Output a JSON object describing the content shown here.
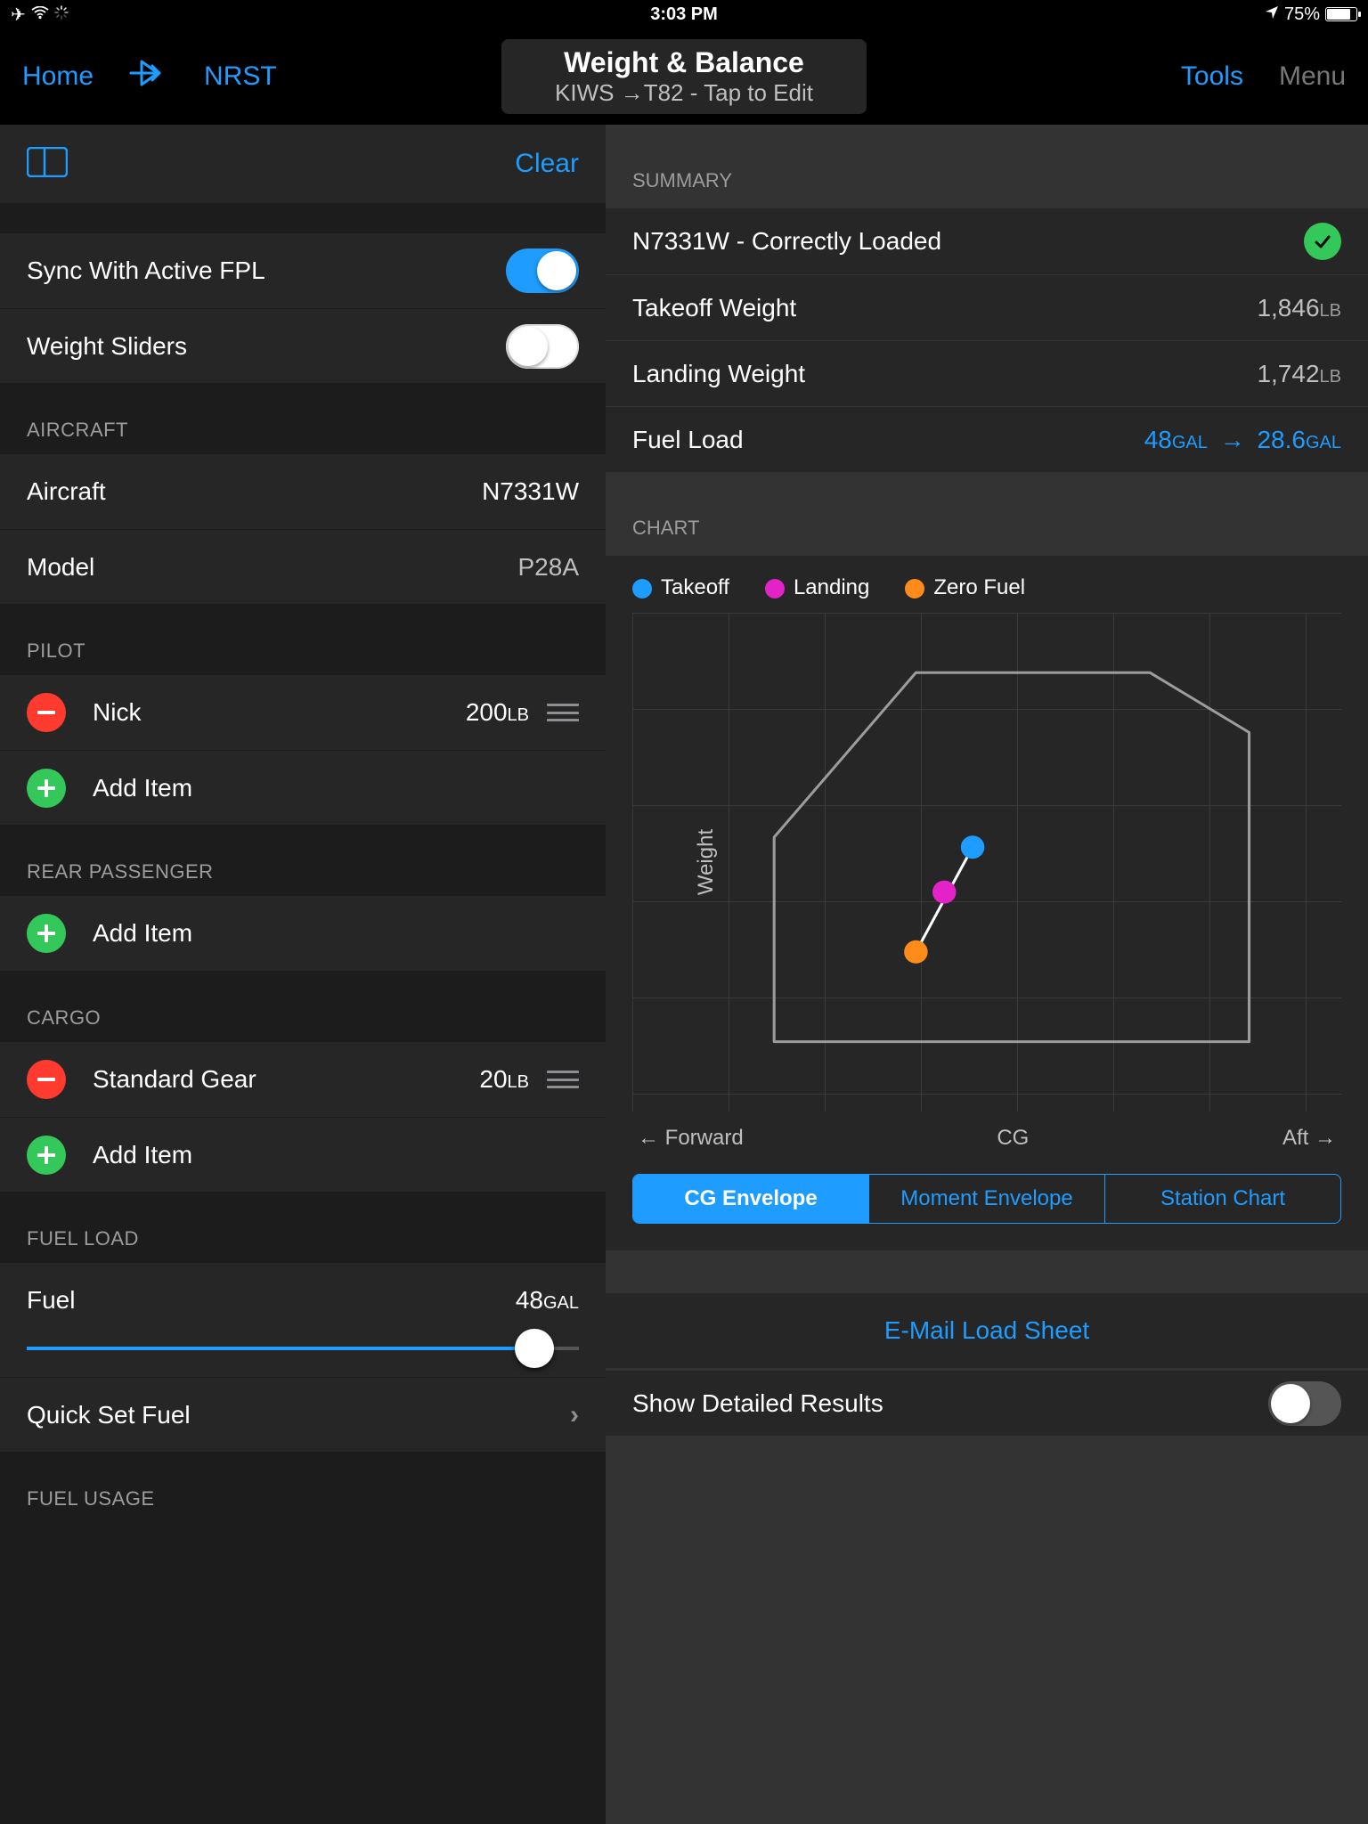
{
  "status": {
    "time": "3:03 PM",
    "battery": "75%"
  },
  "nav": {
    "home": "Home",
    "nrst": "NRST",
    "title": "Weight & Balance",
    "subtitle": "KIWS →T82 - Tap to Edit",
    "tools": "Tools",
    "menu": "Menu"
  },
  "left": {
    "clear": "Clear",
    "sync": "Sync With Active FPL",
    "sliders": "Weight Sliders",
    "aircraft_hdr": "AIRCRAFT",
    "aircraft_lbl": "Aircraft",
    "aircraft_val": "N7331W",
    "model_lbl": "Model",
    "model_val": "P28A",
    "pilot_hdr": "PILOT",
    "pilot_name": "Nick",
    "pilot_wt": "200",
    "lb": "LB",
    "add_item": "Add Item",
    "rear_hdr": "REAR PASSENGER",
    "cargo_hdr": "CARGO",
    "gear_lbl": "Standard Gear",
    "gear_wt": "20",
    "fuel_hdr": "FUEL LOAD",
    "fuel_lbl": "Fuel",
    "fuel_val": "48",
    "gal": "GAL",
    "fuel_pct": 92,
    "quickset": "Quick Set Fuel",
    "usage_hdr": "FUEL USAGE"
  },
  "right": {
    "summary_hdr": "SUMMARY",
    "status_line": "N7331W - Correctly Loaded",
    "tow_lbl": "Takeoff Weight",
    "tow_val": "1,846",
    "lb": "LB",
    "ldw_lbl": "Landing Weight",
    "ldw_val": "1,742",
    "fuel_lbl": "Fuel Load",
    "gal": "GAL",
    "fuel_from": "48",
    "fuel_to": "28.6",
    "chart_hdr": "CHART",
    "legend": {
      "t": "Takeoff",
      "l": "Landing",
      "z": "Zero Fuel"
    },
    "ylabel": "Weight",
    "xaxis": {
      "fwd": "← Forward",
      "cg": "CG",
      "aft": "Aft →"
    },
    "seg": {
      "cg": "CG Envelope",
      "mom": "Moment Envelope",
      "station": "Station Chart"
    },
    "email": "E-Mail Load Sheet",
    "detailed": "Show Detailed Results"
  },
  "chart_data": {
    "type": "scatter",
    "title": "CG Envelope",
    "xlabel": "CG",
    "ylabel": "Weight",
    "x_direction": "Forward → Aft",
    "series": [
      {
        "name": "Zero Fuel",
        "x": 0.4,
        "y": 0.32,
        "color": "#ff8c1a"
      },
      {
        "name": "Landing",
        "x": 0.44,
        "y": 0.44,
        "color": "#e323c8"
      },
      {
        "name": "Takeoff",
        "x": 0.48,
        "y": 0.53,
        "color": "#1e9cff"
      }
    ],
    "envelope_polygon_normalized": [
      [
        0.2,
        0.14
      ],
      [
        0.2,
        0.55
      ],
      [
        0.4,
        0.88
      ],
      [
        0.73,
        0.88
      ],
      [
        0.87,
        0.76
      ],
      [
        0.87,
        0.14
      ]
    ],
    "note": "Coordinates are normalized 0..1 (left/bottom = 0); no numeric axis ticks are shown in the source image so absolute weight/CG values are not recoverable."
  }
}
